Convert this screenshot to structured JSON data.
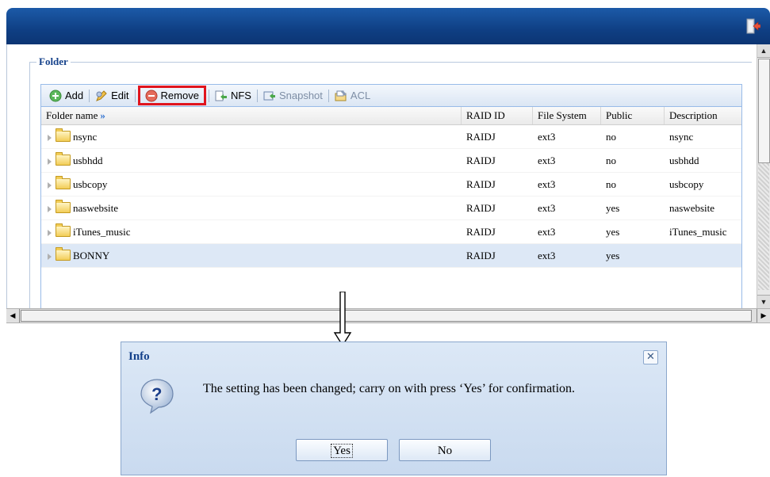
{
  "toolbar": {
    "add": "Add",
    "edit": "Edit",
    "remove": "Remove",
    "nfs": "NFS",
    "snapshot": "Snapshot",
    "acl": "ACL"
  },
  "fieldset": {
    "legend": "Folder"
  },
  "grid": {
    "columns": [
      "Folder name",
      "RAID ID",
      "File System",
      "Public",
      "Description"
    ],
    "rows": [
      {
        "name": "nsync",
        "raid": "RAIDJ",
        "fs": "ext3",
        "public": "no",
        "desc": "nsync"
      },
      {
        "name": "usbhdd",
        "raid": "RAIDJ",
        "fs": "ext3",
        "public": "no",
        "desc": "usbhdd"
      },
      {
        "name": "usbcopy",
        "raid": "RAIDJ",
        "fs": "ext3",
        "public": "no",
        "desc": "usbcopy"
      },
      {
        "name": "naswebsite",
        "raid": "RAIDJ",
        "fs": "ext3",
        "public": "yes",
        "desc": "naswebsite"
      },
      {
        "name": "iTunes_music",
        "raid": "RAIDJ",
        "fs": "ext3",
        "public": "yes",
        "desc": "iTunes_music"
      },
      {
        "name": "BONNY",
        "raid": "RAIDJ",
        "fs": "ext3",
        "public": "yes",
        "desc": ""
      }
    ],
    "selected_row": 5
  },
  "dialog": {
    "title": "Info",
    "message": "The setting has been changed; carry on with press ‘Yes’ for confirmation.",
    "yes": "Yes",
    "no": "No",
    "close_icon": "close-icon",
    "icon": "question-icon"
  },
  "colors": {
    "titlebar": "#0f3f84",
    "highlight": "#e0141e",
    "dialog_bg": "#c9daef"
  }
}
